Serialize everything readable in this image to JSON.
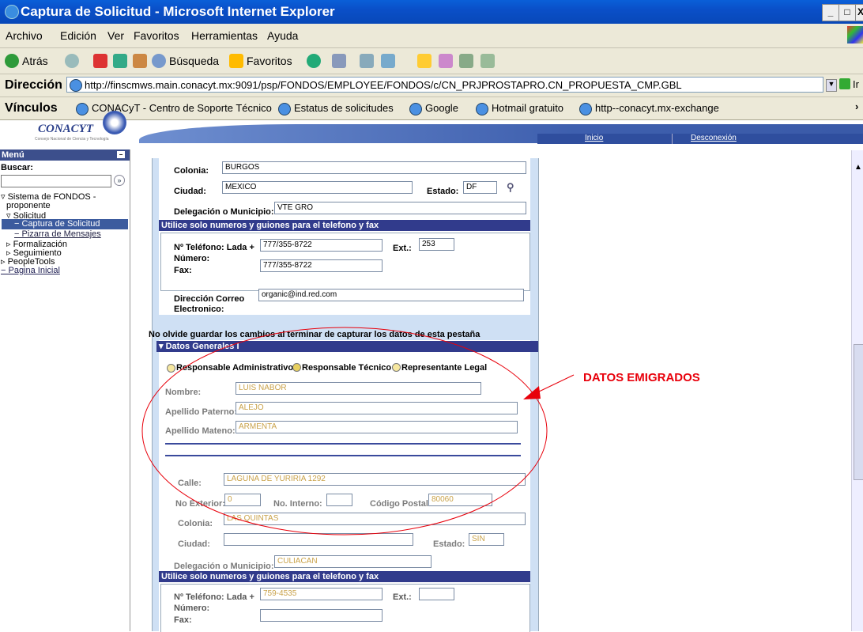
{
  "window": {
    "title": "Captura de Solicitud - Microsoft Internet Explorer",
    "controls": [
      "_",
      "□",
      "X"
    ]
  },
  "menubar": [
    "Archivo",
    "Edición",
    "Ver",
    "Favoritos",
    "Herramientas",
    "Ayuda"
  ],
  "toolbar": {
    "back": "Atrás",
    "search": "Búsqueda",
    "favorites": "Favoritos"
  },
  "address": {
    "label": "Dirección",
    "url": "http://finscmws.main.conacyt.mx:9091/psp/FONDOS/EMPLOYEE/FONDOS/c/CN_PRJPROSTAPRO.CN_PROPUESTA_CMP.GBL",
    "go": "Ir"
  },
  "links": {
    "label": "Vínculos",
    "items": [
      "CONACyT - Centro de Soporte Técnico",
      "Estatus de solicitudes",
      "Google",
      "Hotmail gratuito",
      "http--conacyt.mx-exchange"
    ]
  },
  "header": {
    "logo": "CONACYT",
    "logo_sub": "Consejo Nacional de Ciencia y Tecnología",
    "inicio": "Inicio",
    "desconexion": "Desconexión"
  },
  "nav": {
    "menu": "Menú",
    "buscar": "Buscar:",
    "sistema": "Sistema de FONDOS -",
    "sistema2": "proponente",
    "solicitud": "Solicitud",
    "captura": "Captura de Solicitud",
    "pizarra": "Pizarra de Mensajes",
    "formalizacion": "Formalización",
    "seguimiento": "Seguimiento",
    "peopletools": "PeopleTools",
    "pagina": "Pagina Inicial"
  },
  "form1": {
    "colonia_label": "Colonia:",
    "colonia": "BURGOS",
    "ciudad_label": "Ciudad:",
    "ciudad": "MEXICO",
    "estado_label": "Estado:",
    "estado": "DF",
    "delegacion_label": "Delegación o Municipio:",
    "delegacion": "VTE GRO",
    "bar": "Utilice solo numeros y guiones para el telefono y fax",
    "tel_label": "Nº Teléfono: Lada +",
    "tel_label2": "Número:",
    "tel": "777/355-8722",
    "ext_label": "Ext.:",
    "ext": "253",
    "fax_label": "Fax:",
    "fax": "777/355-8722",
    "correo_label": "Dirección Correo",
    "correo_label2": "Electronico:",
    "correo": "organic@ind.red.com"
  },
  "notice": "No olvide guardar los cambios al terminar de capturar los datos de esta pestaña",
  "datos": {
    "bar": "Datos Generales I",
    "radio1": "Responsable Administrativo",
    "radio2": "Responsable Técnico",
    "radio3": "Representante Legal",
    "nombre_label": "Nombre:",
    "nombre": "LUIS NABOR",
    "paterno_label": "Apellido Paterno:",
    "paterno": "ALEJO",
    "materno_label": "Apellido Mateno:",
    "materno": "ARMENTA",
    "calle_label": "Calle:",
    "calle": "LAGUNA DE YURIRIA 1292",
    "noext_label": "No Exterior:",
    "noext": "0",
    "noint_label": "No. Interno:",
    "noint": "",
    "cp_label": "Código Postal:",
    "cp": "80060",
    "colonia_label": "Colonia:",
    "colonia": "LAS QUINTAS",
    "ciudad_label": "Ciudad:",
    "ciudad": "",
    "estado_label": "Estado:",
    "estado": "SIN",
    "delegacion_label": "Delegación o Municipio:",
    "delegacion": "CULIACAN",
    "bar2": "Utilice solo numeros y guiones para el telefono y fax",
    "tel_label": "Nº Teléfono: Lada +",
    "tel_label2": "Número:",
    "tel": "759-4535",
    "ext_label": "Ext.:",
    "ext": "",
    "fax_label": "Fax:",
    "fax": ""
  },
  "annotation": {
    "text": "DATOS EMIGRADOS",
    "color": "#e8000b"
  },
  "colors": {
    "ie_blue": "#0a4fc8",
    "ps_bar": "#313b8c",
    "form_bg": "#cfe0f4"
  }
}
